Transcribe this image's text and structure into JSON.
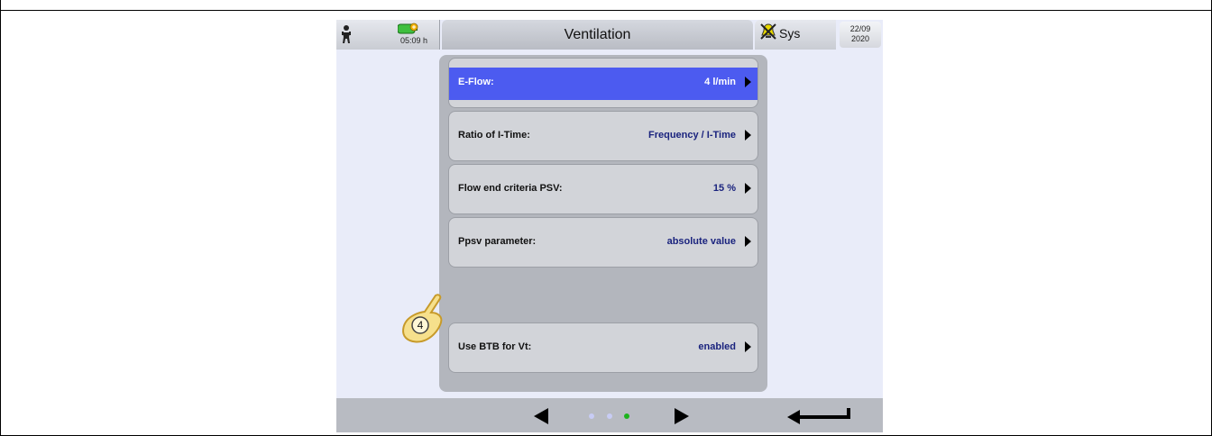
{
  "header": {
    "battery_time": "05:09 h",
    "title": "Ventilation",
    "alarm_label": "Sys",
    "date_line1": "22/09",
    "date_line2": "2020"
  },
  "settings": [
    {
      "label": "E-Flow:",
      "value": "4 l/min",
      "selected": true
    },
    {
      "label": "Ratio of I-Time:",
      "value": "Frequency / I-Time",
      "selected": false
    },
    {
      "label": "Flow end criteria PSV:",
      "value": "15 %",
      "selected": false
    },
    {
      "label": "Ppsv parameter:",
      "value": "absolute value",
      "selected": false
    },
    {
      "label": "Use BTB for Vt:",
      "value": "enabled",
      "selected": false
    }
  ],
  "marker": {
    "number": "4"
  },
  "pagination": {
    "total_pages": 3,
    "current_page": 3
  },
  "colors": {
    "selected_row": "#4c5bf0",
    "value_text": "#1a237e",
    "active_dot": "#1db31d",
    "inactive_dot": "#c8ccf5"
  },
  "icons": [
    "patient-icon",
    "battery-icon",
    "alarm-silenced-icon",
    "prev-arrow-icon",
    "next-arrow-icon",
    "enter-icon",
    "finger-pointer-icon"
  ]
}
